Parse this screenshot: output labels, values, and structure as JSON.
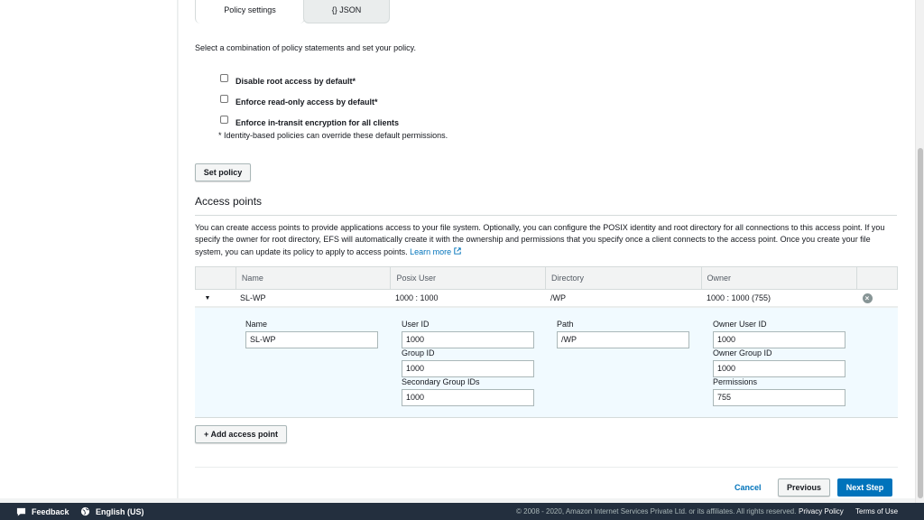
{
  "tabs": [
    {
      "label": "Policy settings",
      "active": true
    },
    {
      "label": "{} JSON",
      "active": false
    }
  ],
  "policy": {
    "intro": "Select a combination of policy statements and set your policy.",
    "options": [
      {
        "label": "Disable root access by default*",
        "checked": false
      },
      {
        "label": "Enforce read-only access by default*",
        "checked": false
      },
      {
        "label": "Enforce in-transit encryption for all clients",
        "checked": false
      }
    ],
    "note": "* Identity-based policies can override these default permissions.",
    "set_button": "Set policy"
  },
  "access_points": {
    "heading": "Access points",
    "description": "You can create access points to provide applications access to your file system. Optionally, you can configure the POSIX identity and root directory for all connections to this access point. If you specify the owner for root directory, EFS will automatically create it with the ownership and permissions that you specify once a client connects to the access point. Once you create your file system, you can update its policy to apply to access points.",
    "learn_more": "Learn more",
    "columns": [
      "Name",
      "Posix User",
      "Directory",
      "Owner"
    ],
    "rows": [
      {
        "name": "SL-WP",
        "posix_user": "1000 : 1000",
        "directory": "/WP",
        "owner": "1000 : 1000 (755)"
      }
    ],
    "detail": {
      "name_label": "Name",
      "name_value": "SL-WP",
      "user_id_label": "User ID",
      "user_id_value": "1000",
      "group_id_label": "Group ID",
      "group_id_value": "1000",
      "secondary_label": "Secondary Group IDs",
      "secondary_value": "1000",
      "path_label": "Path",
      "path_value": "/WP",
      "owner_user_label": "Owner User ID",
      "owner_user_value": "1000",
      "owner_group_label": "Owner Group ID",
      "owner_group_value": "1000",
      "permissions_label": "Permissions",
      "permissions_value": "755"
    },
    "add_button": "+ Add access point"
  },
  "wizard": {
    "cancel": "Cancel",
    "previous": "Previous",
    "next": "Next Step"
  },
  "footer": {
    "feedback": "Feedback",
    "language": "English (US)",
    "copyright": "© 2008 - 2020, Amazon Internet Services Private Ltd. or its affiliates. All rights reserved.",
    "privacy": "Privacy Policy",
    "terms": "Terms of Use"
  },
  "colors": {
    "accent": "#0073bb",
    "footer_bg": "#232f3e",
    "detail_bg": "#f1faff"
  },
  "icons": [
    "caret-down-icon",
    "remove-icon",
    "external-link-icon",
    "feedback-icon",
    "globe-icon"
  ]
}
